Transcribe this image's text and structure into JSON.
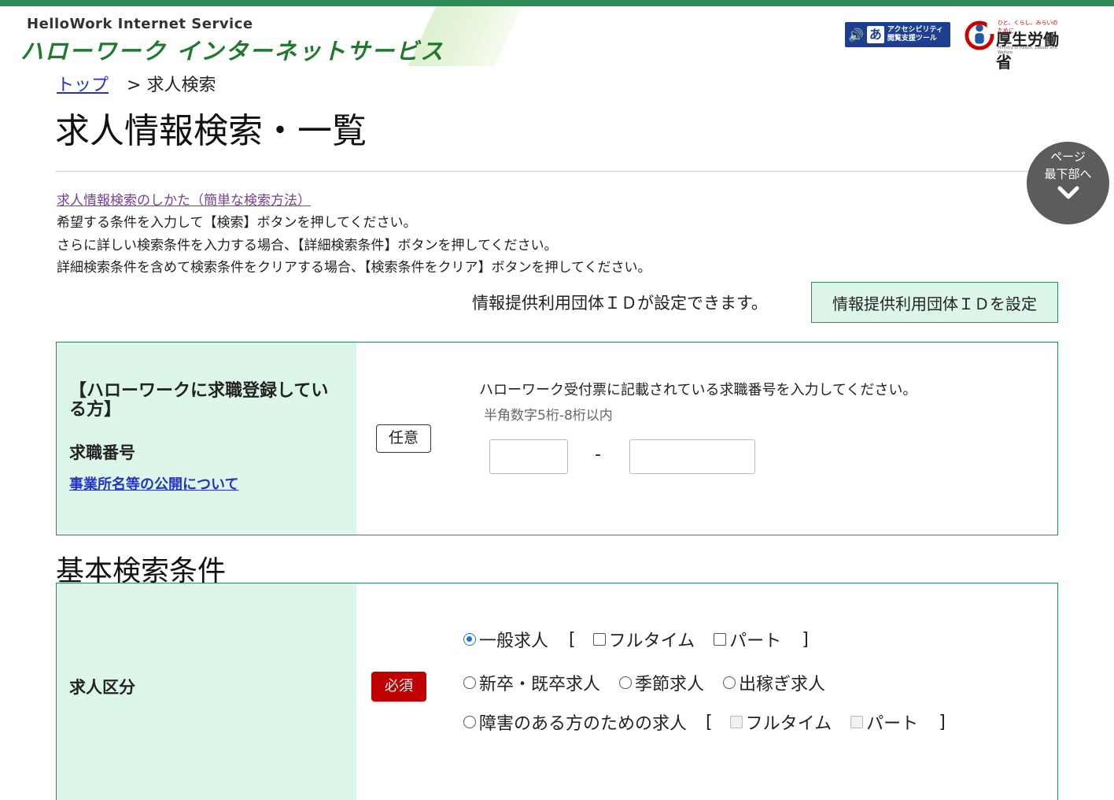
{
  "header": {
    "logo_en": "HelloWork Internet Service",
    "logo_ja": "ハローワーク インターネットサービス",
    "accessibility_tool": {
      "line1": "アクセシビリティ",
      "line2": "閲覧支援ツール"
    },
    "ministry": {
      "tagline": "ひと、くらし、みらいのために",
      "name": "厚生労働省",
      "name_en": "Ministry of Health, Labour and Welfare"
    }
  },
  "breadcrumb": {
    "top": "トップ",
    "separator": ">",
    "current": "求人検索"
  },
  "page_title": "求人情報検索・一覧",
  "back_to_bottom": {
    "line1": "ページ",
    "line2": "最下部へ"
  },
  "help_link": "求人情報検索のしかた（簡単な検索方法）",
  "instructions": [
    "希望する条件を入力して【検索】ボタンを押してください。",
    "さらに詳しい検索条件を入力する場合、【詳細検索条件】ボタンを押してください。",
    "詳細検索条件を含めて検索条件をクリアする場合、【検索条件をクリア】ボタンを押してください。"
  ],
  "org_id": {
    "text": "情報提供利用団体ＩＤが設定できます。",
    "button": "情報提供利用団体ＩＤを設定"
  },
  "job_seeker_box": {
    "heading": "【ハローワークに求職登録している方】",
    "field_label": "求職番号",
    "link": "事業所名等の公開について",
    "tag": "任意",
    "description": "ハローワーク受付票に記載されている求職番号を入力してください。",
    "hint": "半角数字5桁-8桁以内",
    "separator": "-",
    "input1_value": "",
    "input2_value": ""
  },
  "basic_section_title": "基本検索条件",
  "job_type": {
    "label": "求人区分",
    "tag": "必須",
    "row1": {
      "radio": "一般求人",
      "open": "[",
      "opt1": "フルタイム",
      "opt2": "パート",
      "close": "]"
    },
    "row2": {
      "radio1": "新卒・既卒求人",
      "radio2": "季節求人",
      "radio3": "出稼ぎ求人"
    },
    "row3": {
      "radio": "障害のある方のための求人",
      "open": "[",
      "opt1": "フルタイム",
      "opt2": "パート",
      "close": "]"
    },
    "selected": "一般求人"
  },
  "colors": {
    "brand_green": "#2e8b57",
    "label_bg": "#dcf7ea",
    "required_red": "#c00000",
    "link_blue": "#2233cc"
  }
}
